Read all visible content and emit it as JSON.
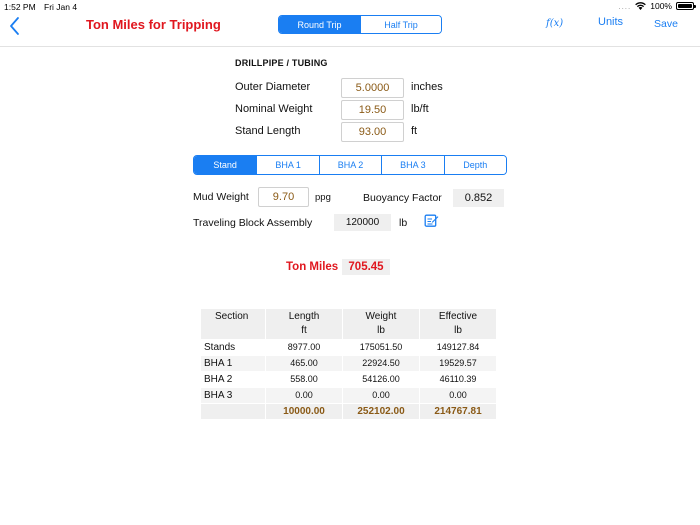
{
  "status": {
    "time": "1:52 PM",
    "date": "Fri Jan 4",
    "signal": "....",
    "battery": "100%"
  },
  "nav": {
    "title": "Ton Miles for Tripping",
    "segments": [
      {
        "label": "Round Trip",
        "selected": true
      },
      {
        "label": "Half Trip",
        "selected": false
      }
    ],
    "fx_label": "f(x)",
    "units_label": "Units",
    "save_label": "Save"
  },
  "drillpipe": {
    "heading": "DRILLPIPE / TUBING",
    "outer_diameter": {
      "label": "Outer Diameter",
      "value": "5.0000",
      "unit": "inches"
    },
    "nominal_weight": {
      "label": "Nominal Weight",
      "value": "19.50",
      "unit": "lb/ft"
    },
    "stand_length": {
      "label": "Stand Length",
      "value": "93.00",
      "unit": "ft"
    }
  },
  "tabs": [
    {
      "label": "Stand",
      "selected": true
    },
    {
      "label": "BHA 1",
      "selected": false
    },
    {
      "label": "BHA 2",
      "selected": false
    },
    {
      "label": "BHA 3",
      "selected": false
    },
    {
      "label": "Depth",
      "selected": false
    }
  ],
  "mud": {
    "label": "Mud Weight",
    "value": "9.70",
    "unit": "ppg"
  },
  "buoyancy": {
    "label": "Buoyancy Factor",
    "value": "0.852"
  },
  "tba": {
    "label": "Traveling Block Assembly",
    "value": "120000",
    "unit": "lb"
  },
  "ton_miles": {
    "label": "Ton Miles",
    "value": "705.45"
  },
  "table": {
    "headers": [
      {
        "title": "Section",
        "unit": ""
      },
      {
        "title": "Length",
        "unit": "ft"
      },
      {
        "title": "Weight",
        "unit": "lb"
      },
      {
        "title": "Effective",
        "unit": "lb"
      }
    ],
    "rows": [
      [
        "Stands",
        "8977.00",
        "175051.50",
        "149127.84"
      ],
      [
        "BHA 1",
        "465.00",
        "22924.50",
        "19529.57"
      ],
      [
        "BHA 2",
        "558.00",
        "54126.00",
        "46110.39"
      ],
      [
        "BHA 3",
        "0.00",
        "0.00",
        "0.00"
      ]
    ],
    "totals": [
      "",
      "10000.00",
      "252102.00",
      "214767.81"
    ]
  },
  "colors": {
    "accent": "#1a7ef2",
    "title_red": "#e0171f",
    "value_brown": "#8a5a16"
  }
}
